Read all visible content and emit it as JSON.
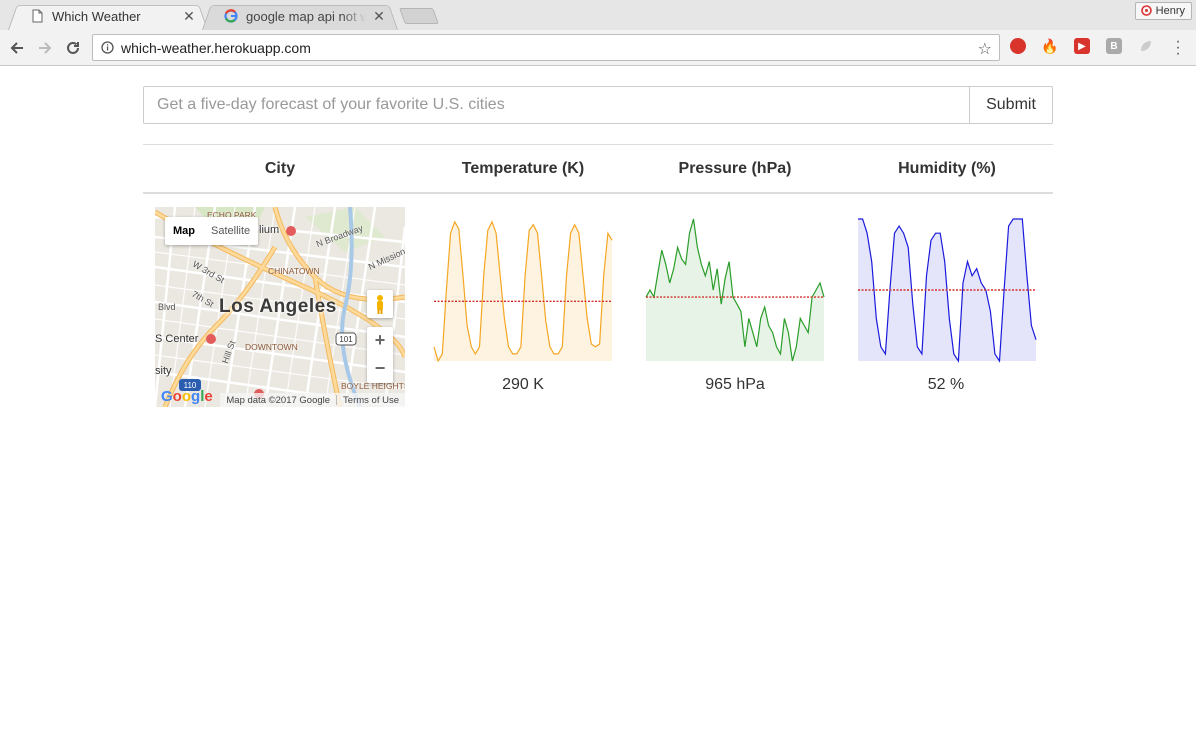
{
  "browser": {
    "tabs": [
      {
        "title": "Which Weather",
        "active": true,
        "favicon": "page-icon"
      },
      {
        "title": "google map api not wo",
        "active": false,
        "favicon": "google-icon"
      }
    ],
    "profile_name": "Henry",
    "url": "which-weather.herokuapp.com",
    "close_glyph": "✕"
  },
  "search": {
    "placeholder": "Get a five-day forecast of your favorite U.S. cities",
    "value": "",
    "submit_label": "Submit"
  },
  "table": {
    "headers": [
      "City",
      "Temperature (K)",
      "Pressure (hPa)",
      "Humidity (%)"
    ]
  },
  "map": {
    "type_options": [
      "Map",
      "Satellite"
    ],
    "selected_type": "Map",
    "city_label": "Los Angeles",
    "labels": [
      "ECHO PARK",
      "CHINATOWN",
      "DOWNTOWN",
      "BOYLE HEIGHTS",
      "N Broadway",
      "N Mission",
      "W 3rd St",
      "7th St",
      "Blvd",
      "S Center",
      "Hill St",
      "sity",
      "lium",
      "101",
      "110"
    ],
    "zoom_in": "+",
    "zoom_out": "−",
    "attribution": "Map data ©2017 Google",
    "terms": "Terms of Use",
    "logo": "Google",
    "colors": {
      "land": "#ebe8e1",
      "road": "#ffffff",
      "highway": "#f8c877",
      "park": "#c8dfb0"
    }
  },
  "chart_data": [
    {
      "type": "area",
      "name": "temperature",
      "color": "#f5a623",
      "fill": "#fdf3e0",
      "values": [
        0.1,
        0.0,
        0.05,
        0.5,
        0.9,
        0.98,
        0.93,
        0.6,
        0.25,
        0.1,
        0.05,
        0.1,
        0.6,
        0.92,
        0.98,
        0.9,
        0.6,
        0.3,
        0.1,
        0.05,
        0.05,
        0.1,
        0.6,
        0.92,
        0.96,
        0.9,
        0.6,
        0.28,
        0.1,
        0.05,
        0.05,
        0.1,
        0.6,
        0.9,
        0.96,
        0.9,
        0.6,
        0.3,
        0.12,
        0.1,
        0.12,
        0.6,
        0.9,
        0.85
      ],
      "average": 0.42,
      "current_label": "290 K"
    },
    {
      "type": "area",
      "name": "pressure",
      "color": "#2a9d2a",
      "fill": "#e6f3e6",
      "values": [
        0.45,
        0.5,
        0.45,
        0.62,
        0.78,
        0.68,
        0.55,
        0.65,
        0.8,
        0.72,
        0.68,
        0.9,
        1.0,
        0.8,
        0.68,
        0.6,
        0.7,
        0.5,
        0.65,
        0.4,
        0.58,
        0.7,
        0.45,
        0.4,
        0.35,
        0.1,
        0.3,
        0.2,
        0.1,
        0.3,
        0.38,
        0.25,
        0.2,
        0.1,
        0.05,
        0.3,
        0.2,
        0.0,
        0.1,
        0.3,
        0.25,
        0.2,
        0.45,
        0.5,
        0.55,
        0.45
      ],
      "average": 0.45,
      "current_label": "965 hPa"
    },
    {
      "type": "area",
      "name": "humidity",
      "color": "#1a1adc",
      "fill": "#e4e4fa",
      "values": [
        1.0,
        1.0,
        0.9,
        0.7,
        0.3,
        0.1,
        0.05,
        0.5,
        0.9,
        0.95,
        0.9,
        0.8,
        0.4,
        0.1,
        0.05,
        0.6,
        0.85,
        0.9,
        0.9,
        0.7,
        0.3,
        0.05,
        0.0,
        0.55,
        0.7,
        0.6,
        0.65,
        0.55,
        0.5,
        0.35,
        0.05,
        0.0,
        0.5,
        0.95,
        1.0,
        1.0,
        1.0,
        0.6,
        0.25,
        0.15
      ],
      "average": 0.5,
      "current_label": "52 %"
    }
  ]
}
